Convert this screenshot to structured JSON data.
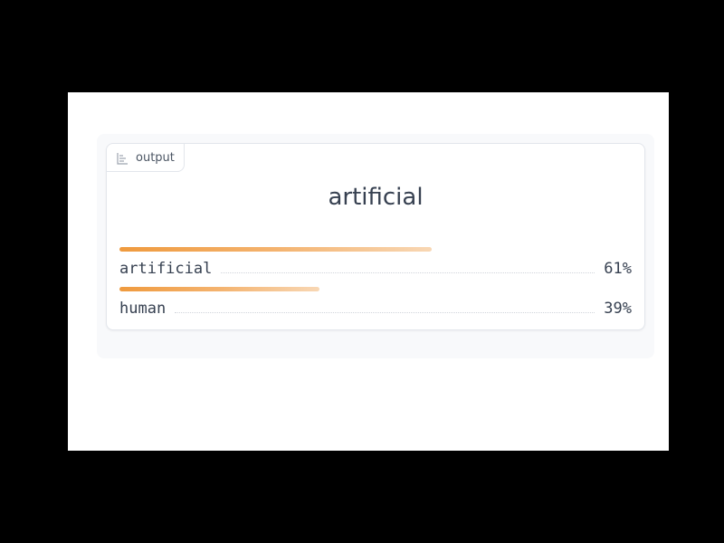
{
  "output_block": {
    "label": "output",
    "label_icon": "bar-chart-icon",
    "headline": "artificial",
    "confidences": [
      {
        "label": "artificial",
        "value_text": "61%",
        "fraction": 0.61
      },
      {
        "label": "human",
        "value_text": "39%",
        "fraction": 0.39
      }
    ],
    "colors": {
      "bar_start": "#ef9a3e",
      "bar_end": "#f8d7b4",
      "text": "#374151"
    }
  }
}
